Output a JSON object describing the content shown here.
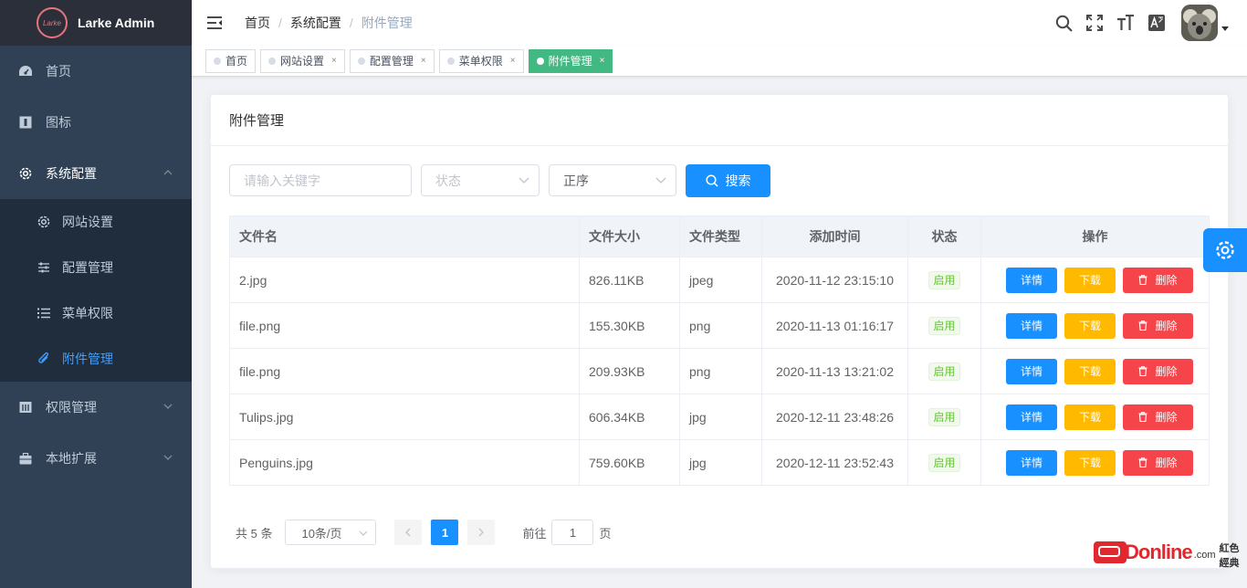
{
  "app": {
    "logo_text": "Larke",
    "title": "Larke Admin"
  },
  "sidebar": {
    "items": [
      {
        "label": "首页"
      },
      {
        "label": "图标"
      },
      {
        "label": "系统配置"
      },
      {
        "label": "权限管理"
      },
      {
        "label": "本地扩展"
      }
    ],
    "sub_items": [
      {
        "label": "网站设置"
      },
      {
        "label": "配置管理"
      },
      {
        "label": "菜单权限"
      },
      {
        "label": "附件管理"
      }
    ]
  },
  "breadcrumb": [
    "首页",
    "系统配置",
    "附件管理"
  ],
  "tags": [
    {
      "label": "首页",
      "active": false
    },
    {
      "label": "网站设置",
      "active": false,
      "close": "×"
    },
    {
      "label": "配置管理",
      "active": false,
      "close": "×"
    },
    {
      "label": "菜单权限",
      "active": false,
      "close": "×"
    },
    {
      "label": "附件管理",
      "active": true,
      "close": "×"
    }
  ],
  "card": {
    "title": "附件管理"
  },
  "filters": {
    "keyword_placeholder": "请输入关键字",
    "status_placeholder": "状态",
    "order_value": "正序",
    "search_label": "搜索"
  },
  "table": {
    "columns": [
      "文件名",
      "文件大小",
      "文件类型",
      "添加时间",
      "状态",
      "操作"
    ],
    "rows": [
      {
        "name": "2.jpg",
        "size": "826.11KB",
        "type": "jpeg",
        "time": "2020-11-12 23:15:10",
        "status": "启用"
      },
      {
        "name": "file.png",
        "size": "155.30KB",
        "type": "png",
        "time": "2020-11-13 01:16:17",
        "status": "启用"
      },
      {
        "name": "file.png",
        "size": "209.93KB",
        "type": "png",
        "time": "2020-11-13 13:21:02",
        "status": "启用"
      },
      {
        "name": "Tulips.jpg",
        "size": "606.34KB",
        "type": "jpg",
        "time": "2020-12-11 23:48:26",
        "status": "启用"
      },
      {
        "name": "Penguins.jpg",
        "size": "759.60KB",
        "type": "jpg",
        "time": "2020-12-11 23:52:43",
        "status": "启用"
      }
    ],
    "actions": {
      "detail": "详情",
      "download": "下载",
      "delete": "删除"
    }
  },
  "pagination": {
    "total": "共 5 条",
    "page_size": "10条/页",
    "current": "1",
    "goto_prefix": "前往",
    "goto_value": "1",
    "goto_suffix": "页"
  },
  "watermark": {
    "brand": "Donline",
    "com": ".com",
    "cn": "紅色經典"
  },
  "colors": {
    "sidebar_bg": "#304156",
    "primary": "#1890ff",
    "warning": "#ffba00",
    "danger": "#f5454a",
    "active_tag": "#42b983"
  }
}
